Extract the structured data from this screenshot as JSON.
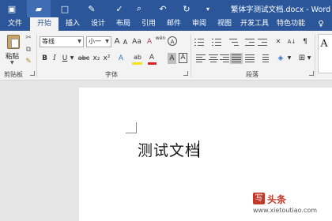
{
  "window": {
    "title": "繁体字测试文档.docx - Word"
  },
  "quick_access": {
    "icons": [
      "save-icon",
      "open-folder-icon",
      "new-document-icon",
      "format-painter-icon",
      "print-preview-icon",
      "undo-icon",
      "redo-icon",
      "customize-icon"
    ]
  },
  "tabs": [
    "文件",
    "开始",
    "插入",
    "设计",
    "布局",
    "引用",
    "邮件",
    "审阅",
    "视图",
    "开发工具",
    "特色功能"
  ],
  "active_tab": "开始",
  "ribbon": {
    "clipboard": {
      "paste_label": "粘贴",
      "group_label": "剪贴板",
      "icons": [
        "cut-icon",
        "copy-icon",
        "format-painter-icon"
      ]
    },
    "font": {
      "group_label": "字体",
      "font_name": "等线",
      "font_size": "小一",
      "grow_label": "A",
      "shrink_label": "A",
      "case_label": "Aa",
      "clear_label": "A",
      "phonetic_label": "wén",
      "enclose_label": "A",
      "bold_label": "B",
      "italic_label": "I",
      "underline_label": "U",
      "strike_label": "abc",
      "subscript_label": "x₂",
      "superscript_label": "x²",
      "effects_label": "A",
      "highlight_label": "ab",
      "font_color_label": "A",
      "shading_label": "A",
      "border_label": "A",
      "highlight_color": "#f5e11a",
      "font_color": "#e02020"
    },
    "paragraph": {
      "group_label": "段落",
      "sort_label": "A↓",
      "marks_label": "¶"
    },
    "styles": {
      "preview_label": "A"
    }
  },
  "document": {
    "body_text": "测试文档"
  },
  "watermark": {
    "logo_text": "写",
    "name": "头条",
    "url": "www.xietoutiao.com"
  },
  "colors": {
    "titlebar": "#2b579a",
    "ribbon": "#f3f3f3",
    "workspace": "#e6e6e6"
  }
}
